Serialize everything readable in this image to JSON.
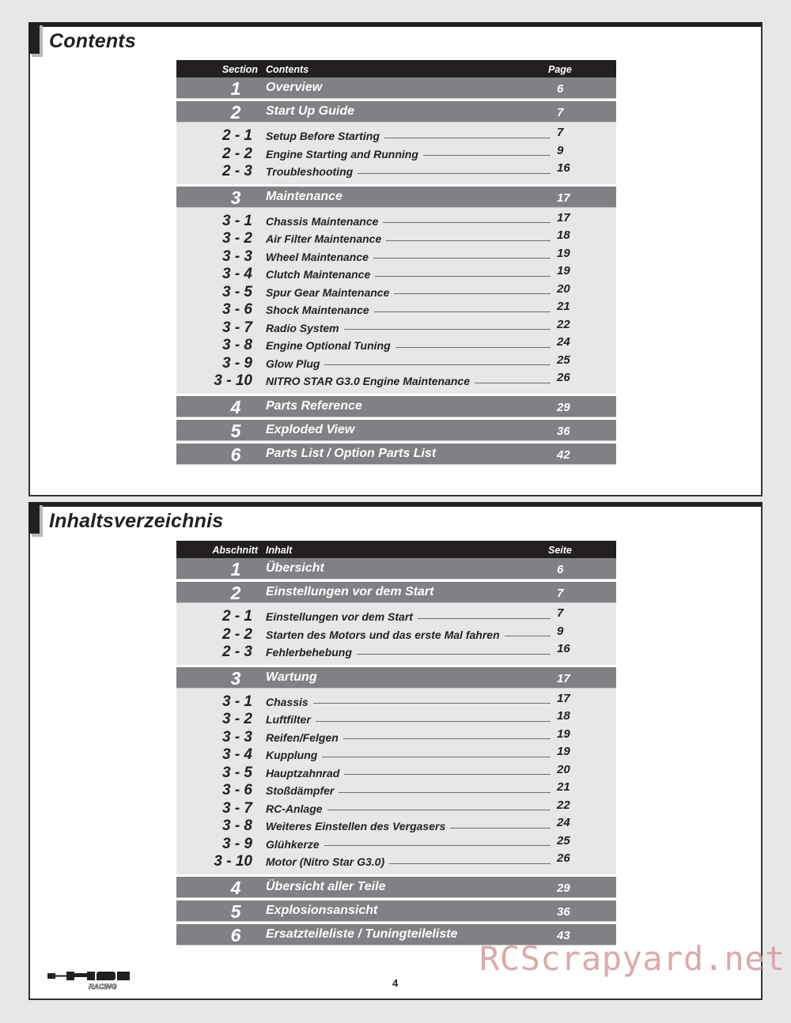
{
  "sections": [
    {
      "id": "en",
      "title": "Contents",
      "headers": {
        "section": "Section",
        "contents": "Contents",
        "page": "Page"
      },
      "groups": [
        {
          "num": "1",
          "title": "Overview",
          "page": "6",
          "subs": []
        },
        {
          "num": "2",
          "title": "Start Up Guide",
          "page": "7",
          "subs": [
            {
              "num": "2 - 1",
              "title": "Setup Before Starting",
              "page": "7"
            },
            {
              "num": "2 - 2",
              "title": "Engine Starting and Running",
              "page": "9"
            },
            {
              "num": "2 - 3",
              "title": "Troubleshooting",
              "page": "16"
            }
          ]
        },
        {
          "num": "3",
          "title": "Maintenance",
          "page": "17",
          "subs": [
            {
              "num": "3 - 1",
              "title": "Chassis Maintenance",
              "page": "17"
            },
            {
              "num": "3 - 2",
              "title": "Air Filter Maintenance",
              "page": "18"
            },
            {
              "num": "3 - 3",
              "title": "Wheel Maintenance",
              "page": "19"
            },
            {
              "num": "3 - 4",
              "title": "Clutch Maintenance",
              "page": "19"
            },
            {
              "num": "3 - 5",
              "title": "Spur Gear Maintenance",
              "page": "20"
            },
            {
              "num": "3 - 6",
              "title": "Shock Maintenance",
              "page": "21"
            },
            {
              "num": "3 - 7",
              "title": "Radio System",
              "page": "22"
            },
            {
              "num": "3 - 8",
              "title": "Engine Optional Tuning",
              "page": "24"
            },
            {
              "num": "3 - 9",
              "title": "Glow Plug",
              "page": "25"
            },
            {
              "num": "3 - 10",
              "title": "NITRO STAR G3.0 Engine Maintenance",
              "page": "26"
            }
          ]
        },
        {
          "num": "4",
          "title": "Parts Reference",
          "page": "29",
          "subs": []
        },
        {
          "num": "5",
          "title": "Exploded View",
          "page": "36",
          "subs": []
        },
        {
          "num": "6",
          "title": "Parts List / Option Parts List",
          "page": "42",
          "subs": []
        }
      ]
    },
    {
      "id": "de",
      "title": "Inhaltsverzeichnis",
      "headers": {
        "section": "Abschnitt",
        "contents": "Inhalt",
        "page": "Seite"
      },
      "groups": [
        {
          "num": "1",
          "title": "Übersicht",
          "page": "6",
          "subs": []
        },
        {
          "num": "2",
          "title": "Einstellungen vor dem Start",
          "page": "7",
          "subs": [
            {
              "num": "2 - 1",
              "title": "Einstellungen vor dem Start",
              "page": "7"
            },
            {
              "num": "2 - 2",
              "title": "Starten des Motors und das erste Mal fahren",
              "page": "9"
            },
            {
              "num": "2 - 3",
              "title": "Fehlerbehebung",
              "page": "16"
            }
          ]
        },
        {
          "num": "3",
          "title": "Wartung",
          "page": "17",
          "subs": [
            {
              "num": "3 - 1",
              "title": "Chassis",
              "page": "17"
            },
            {
              "num": "3 - 2",
              "title": "Luftfilter",
              "page": "18"
            },
            {
              "num": "3 - 3",
              "title": "Reifen/Felgen",
              "page": "19"
            },
            {
              "num": "3 - 4",
              "title": "Kupplung",
              "page": "19"
            },
            {
              "num": "3 - 5",
              "title": "Hauptzahnrad",
              "page": "20"
            },
            {
              "num": "3 - 6",
              "title": "Stoßdämpfer",
              "page": "21"
            },
            {
              "num": "3 - 7",
              "title": "RC-Anlage",
              "page": "22"
            },
            {
              "num": "3 - 8",
              "title": "Weiteres Einstellen des Vergasers",
              "page": "24"
            },
            {
              "num": "3 - 9",
              "title": "Glühkerze",
              "page": "25"
            },
            {
              "num": "3 - 10",
              "title": "Motor (Nitro Star G3.0)",
              "page": "26"
            }
          ]
        },
        {
          "num": "4",
          "title": "Übersicht aller Teile",
          "page": "29",
          "subs": []
        },
        {
          "num": "5",
          "title": "Explosionsansicht",
          "page": "36",
          "subs": []
        },
        {
          "num": "6",
          "title": "Ersatzteileliste / Tuningteileliste",
          "page": "43",
          "subs": []
        }
      ]
    }
  ],
  "footer": {
    "logo": "HPI Racing",
    "logo_icon": "hpi-racing-logo",
    "page_number": "4"
  },
  "watermark": "RCScrapyard.net",
  "colors": {
    "header_bar": "#231f20",
    "main_row": "#808184",
    "sub_block": "#e6e7e8",
    "watermark": "#d9a0a3"
  }
}
